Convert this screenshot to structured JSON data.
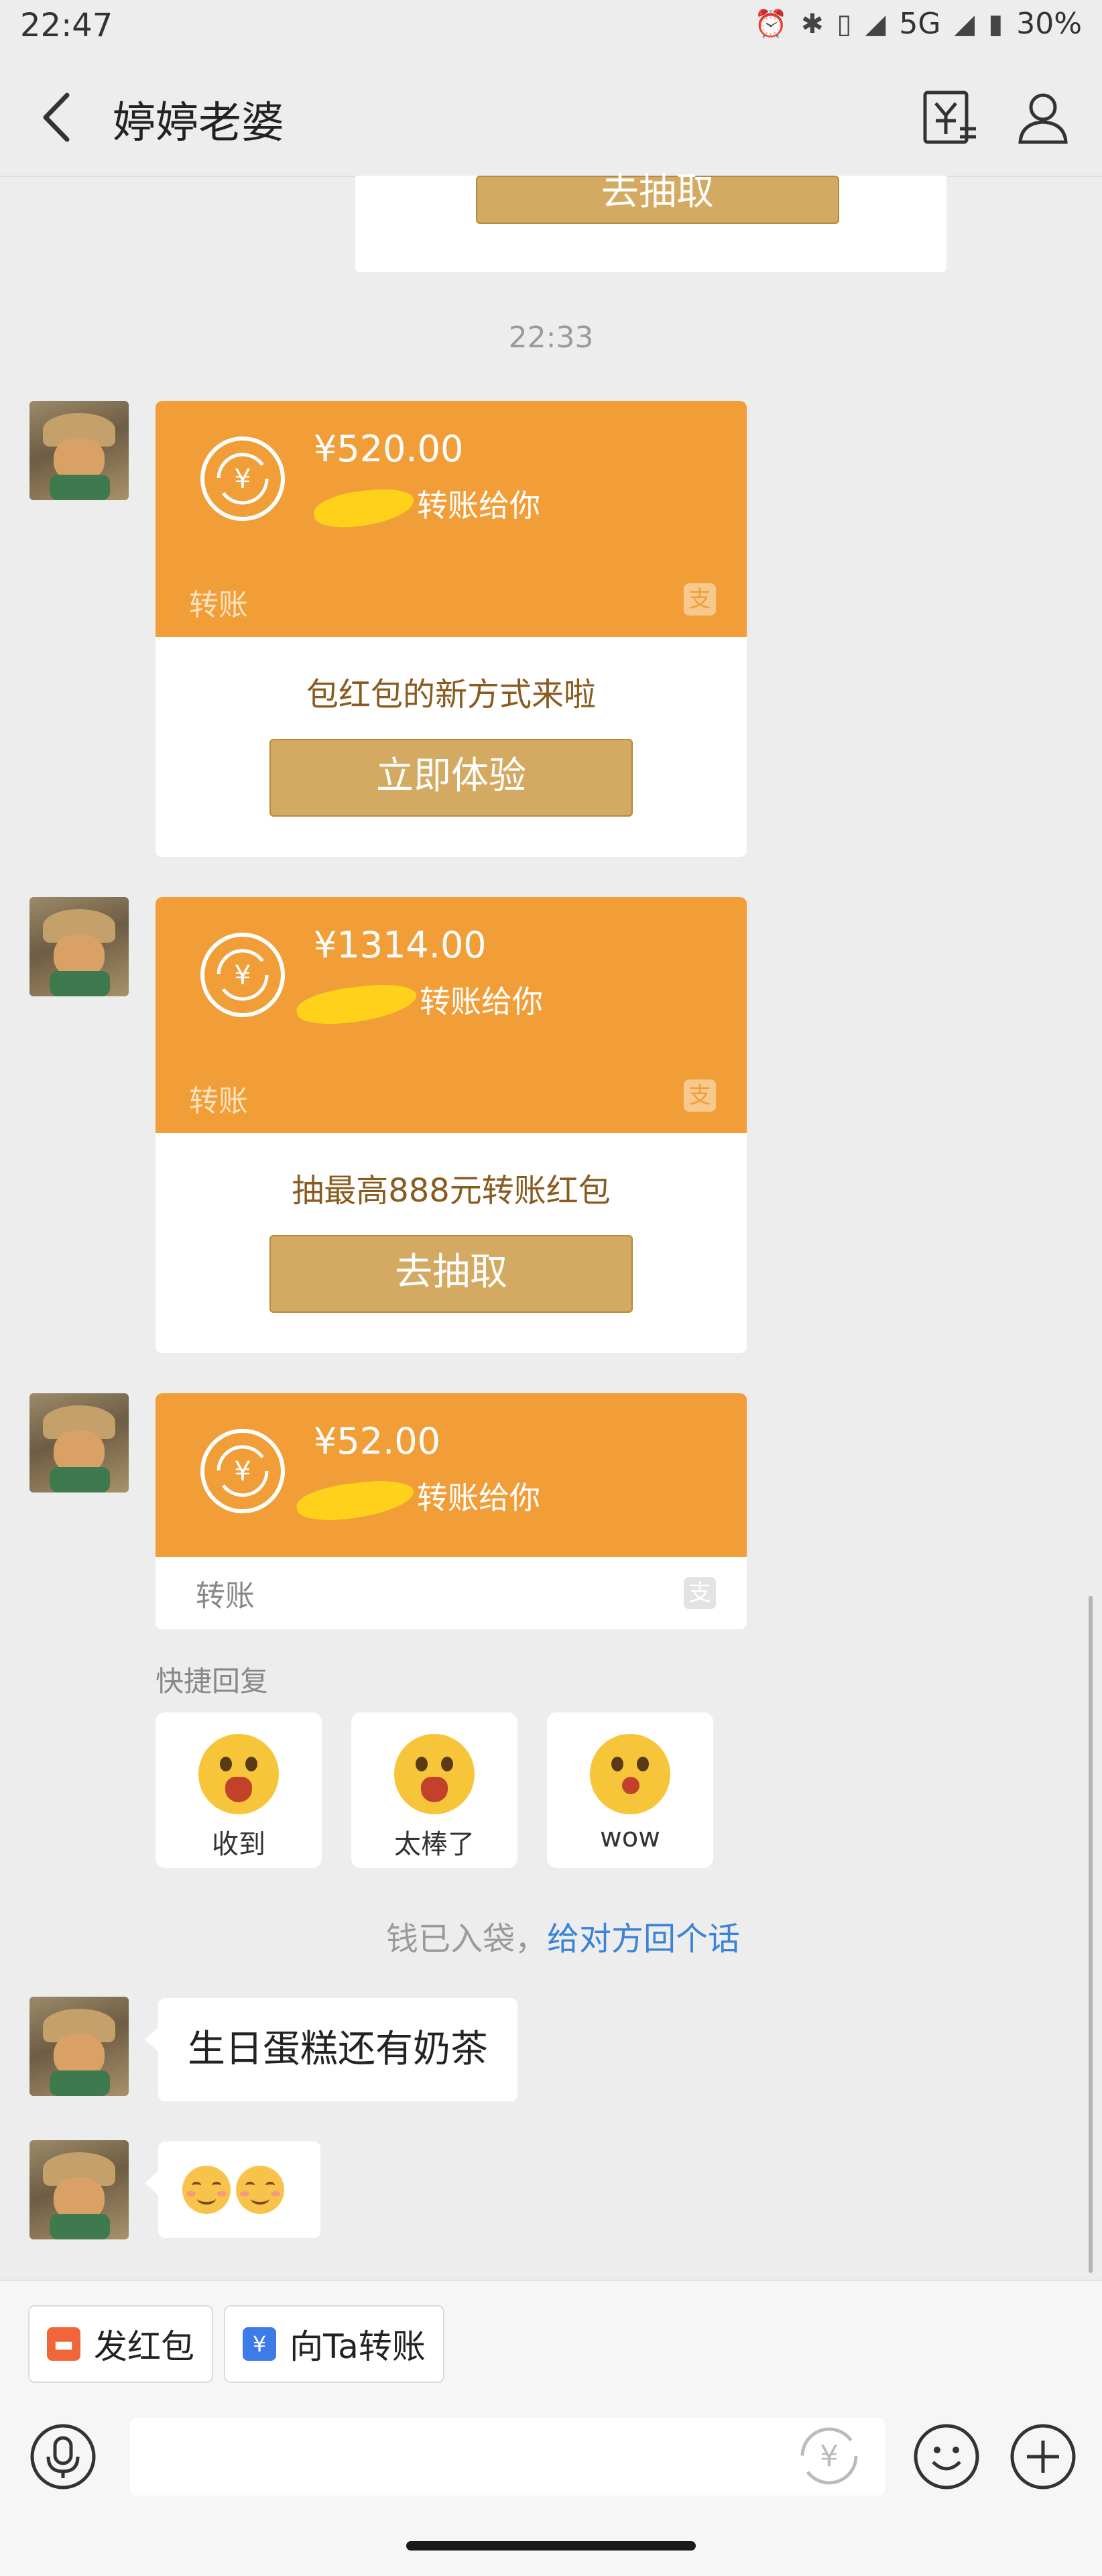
{
  "status_bar": {
    "time": "22:47",
    "network": "5G",
    "battery": "30%"
  },
  "header": {
    "title": "婷婷老婆"
  },
  "top_card": {
    "button_label": "去抽取"
  },
  "timestamp": "22:33",
  "transfers": [
    {
      "amount": "¥520.00",
      "sender_suffix": "转账给你",
      "label": "转账",
      "promo_text": "包红包的新方式来啦",
      "button_label": "立即体验"
    },
    {
      "amount": "¥1314.00",
      "sender_suffix": "转账给你",
      "label": "转账",
      "promo_text": "抽最高888元转账红包",
      "button_label": "去抽取"
    },
    {
      "amount": "¥52.00",
      "sender_suffix": "转账给你",
      "label": "转账"
    }
  ],
  "quick_reply": {
    "title": "快捷回复",
    "options": [
      "收到",
      "太棒了",
      "wow"
    ]
  },
  "money_notice": {
    "text": "钱已入袋，",
    "link": "给对方回个话"
  },
  "messages": [
    {
      "text": "生日蛋糕还有奶茶"
    },
    {
      "emoji": "smile-emoji x2"
    }
  ],
  "bottom_actions": {
    "red_packet": "发红包",
    "transfer": "向Ta转账"
  },
  "colors": {
    "transfer_orange": "#f29e38",
    "gold_button": "#d4aa62",
    "link_blue": "#3a83d6",
    "background": "#ededed"
  }
}
